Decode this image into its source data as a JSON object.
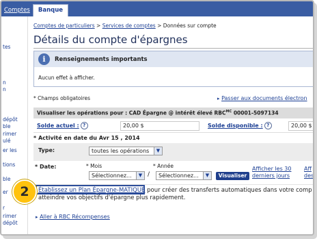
{
  "tabs": {
    "left_label": "Comptes",
    "active_label": "Banque"
  },
  "sidebar": {
    "items": [
      "tes",
      "n",
      "n",
      "dépôt",
      "ble",
      "rimer",
      "ulé",
      "er les",
      "tions",
      "ble",
      "er",
      "r",
      "rimer",
      "dépôt",
      "rimer",
      "és"
    ]
  },
  "breadcrumb": {
    "crumb1": "Comptes de particuliers",
    "sep1": ">",
    "crumb2": "Services de comptes",
    "sep2": ">",
    "current": "Données sur compte"
  },
  "page": {
    "title": "Détails du compte d'épargnes"
  },
  "notice": {
    "heading": "Renseignements importants",
    "message": "Aucun effet à afficher."
  },
  "required_note": "* Champs obligatoires",
  "docs_link": "Passer aux documents électron",
  "account": {
    "header": "Visualiser les opérations pour : CAD Épargne @ intérêt élevé RBC",
    "sup": "MC",
    "number": "00001-5097134",
    "current_label": "Solde actuel :",
    "current_value": "20,00 $",
    "available_label": "Solde disponible :",
    "available_value": "20,00 $",
    "help_icon": "?"
  },
  "activity": {
    "heading": "* Activité en date du Avr 15 , 2014",
    "type_label": "Type:",
    "type_value": "toutes les opérations",
    "date_label": "* Date:",
    "month_label": "* Mois",
    "year_label": "* Année",
    "month_value": "Sélectionnez...",
    "year_value": "Sélectionnez...",
    "slash": "/",
    "view_button": "Visualiser",
    "last30_line1": "Afficher les 30",
    "last30_line2": "derniers jours",
    "more_line1": "Aff",
    "more_line2": "des"
  },
  "promo": {
    "callout_number": "2",
    "link": "Établissez un Plan Épargne-MATIQUE",
    "text_line1": " pour créer des transferts automatiques dans votre comp",
    "text_line2": "atteindre vos objectifs d'épargne plus rapidement."
  },
  "rewards_link": "Aller à RBC Récompenses",
  "colors": {
    "brand_blue": "#3a5da3",
    "link_blue": "#1c3f94",
    "callout_yellow": "#ffc20e",
    "button_blue": "#1f3f8c"
  }
}
